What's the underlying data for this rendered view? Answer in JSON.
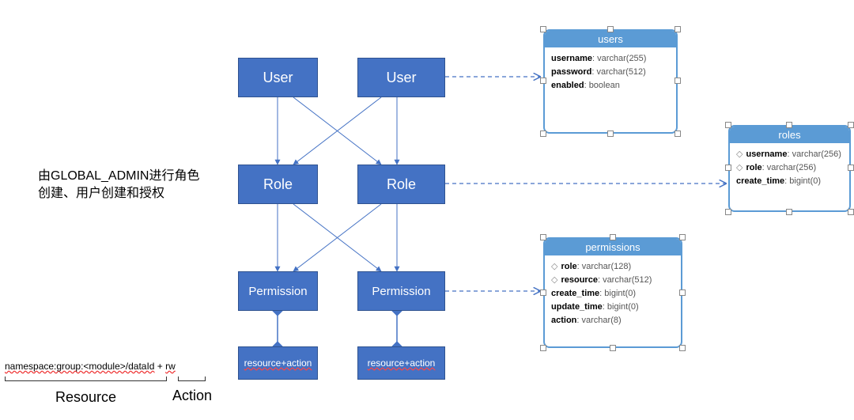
{
  "note": "由GLOBAL_ADMIN进行角色创建、用户创建和授权",
  "boxes": {
    "user": "User",
    "role": "Role",
    "permission": "Permission",
    "resact": "resource+action"
  },
  "format_line": {
    "resource": "namespace:group:<module>/dataId",
    "plus": " + ",
    "action": "rw"
  },
  "labels": {
    "resource": "Resource",
    "action": "Action"
  },
  "db": {
    "users": {
      "title": "users",
      "fields": [
        {
          "name": "username",
          "type": "varchar(255)",
          "key": false
        },
        {
          "name": "password",
          "type": "varchar(512)",
          "key": false
        },
        {
          "name": "enabled",
          "type": "boolean",
          "key": false
        }
      ]
    },
    "roles": {
      "title": "roles",
      "fields": [
        {
          "name": "username",
          "type": "varchar(256)",
          "key": true
        },
        {
          "name": "role",
          "type": "varchar(256)",
          "key": true
        },
        {
          "name": "create_time",
          "type": "bigint(0)",
          "key": false
        }
      ]
    },
    "permissions": {
      "title": "permissions",
      "fields": [
        {
          "name": "role",
          "type": "varchar(128)",
          "key": true
        },
        {
          "name": "resource",
          "type": "varchar(512)",
          "key": true
        },
        {
          "name": "create_time",
          "type": "bigint(0)",
          "key": false
        },
        {
          "name": "update_time",
          "type": "bigint(0)",
          "key": false
        },
        {
          "name": "action",
          "type": "varchar(8)",
          "key": false
        }
      ]
    }
  },
  "chart_data": {
    "type": "diagram",
    "title": "RBAC model and database tables",
    "entities": [
      "User",
      "Role",
      "Permission",
      "resource+action"
    ],
    "relations": [
      {
        "from": "User",
        "to": "Role",
        "kind": "many-to-many"
      },
      {
        "from": "Role",
        "to": "Permission",
        "kind": "many-to-many"
      },
      {
        "from": "Permission",
        "to": "resource+action",
        "kind": "composition-bidirectional"
      }
    ],
    "mappings": [
      {
        "entity": "User",
        "table": "users"
      },
      {
        "entity": "Role",
        "table": "roles"
      },
      {
        "entity": "Permission",
        "table": "permissions"
      }
    ],
    "tables": {
      "users": [
        {
          "col": "username",
          "type": "varchar(255)"
        },
        {
          "col": "password",
          "type": "varchar(512)"
        },
        {
          "col": "enabled",
          "type": "boolean"
        }
      ],
      "roles": [
        {
          "col": "username",
          "type": "varchar(256)",
          "pk": true
        },
        {
          "col": "role",
          "type": "varchar(256)",
          "pk": true
        },
        {
          "col": "create_time",
          "type": "bigint(0)"
        }
      ],
      "permissions": [
        {
          "col": "role",
          "type": "varchar(128)",
          "pk": true
        },
        {
          "col": "resource",
          "type": "varchar(512)",
          "pk": true
        },
        {
          "col": "create_time",
          "type": "bigint(0)"
        },
        {
          "col": "update_time",
          "type": "bigint(0)"
        },
        {
          "col": "action",
          "type": "varchar(8)"
        }
      ]
    },
    "resource_format": "namespace:group:<module>/dataId",
    "action_format": "rw",
    "note_zh": "由GLOBAL_ADMIN进行角色创建、用户创建和授权"
  }
}
